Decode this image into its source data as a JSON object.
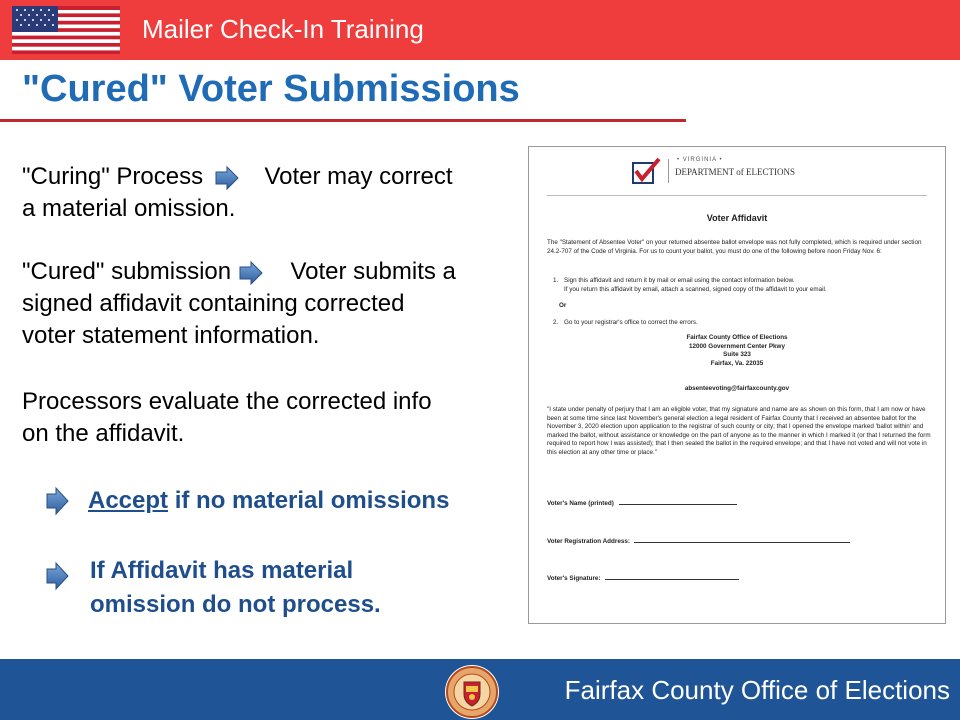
{
  "header": {
    "title": "Mailer Check-In Training"
  },
  "slide": {
    "title": "\"Cured\" Voter Submissions"
  },
  "content": {
    "curing_term": "\"Curing\" Process",
    "curing_desc_1": "Voter may correct",
    "curing_desc_2": "a material omission.",
    "cured_term": "\"Cured\" submission",
    "cured_desc_1": "Voter submits a",
    "cured_desc_2": "signed affidavit containing corrected",
    "cured_desc_3": "voter statement information.",
    "processors_1": "Processors evaluate the corrected info",
    "processors_2": "on the affidavit.",
    "accept_word": "Accept",
    "accept_rest": " if no material omissions",
    "reject_1": "If Affidavit has material",
    "reject_2": "omission do not process."
  },
  "affidavit": {
    "state": "• VIRGINIA •",
    "department": "DEPARTMENT of ELECTIONS",
    "title": "Voter Affidavit",
    "intro": "The \"Statement of Absentee Voter\" on your returned absentee ballot envelope was not fully completed, which is required under section 24.2-707 of the Code of Virginia. For us to count your ballot, you must do one of the following before noon Friday Nov. 6:",
    "step1_num": "1.",
    "step1": "Sign this affidavit and return it by mail or email using the contact information below.",
    "step1_note": "If you return this affidavit by email, attach a scanned, signed copy of the affidavit to your email.",
    "or": "Or",
    "step2_num": "2.",
    "step2": "Go to your registrar's office to correct the errors.",
    "office_name": "Fairfax County Office of Elections",
    "office_street": "12000 Government Center Pkwy",
    "office_suite": "Suite 323",
    "office_city": "Fairfax, Va. 22035",
    "email": "absenteevoting@fairfaxcounty.gov",
    "statement": "\"I state under penalty of perjury that I am an eligible voter, that my signature and name are as shown on this form, that I am now or have been at some time since last November's general election a legal resident of Fairfax County that I received an absentee ballot for the November 3, 2020 election upon application to the registrar of such county or city; that I opened the envelope marked 'ballot within' and marked the ballot, without assistance or knowledge on the part of anyone as to the manner in which I marked it (or that I returned the form required to report how I was assisted); that I then sealed the ballot in the required envelope; and that I have not voted and will not vote in this election at any other time or place.\"",
    "field_name": "Voter's Name (printed)",
    "field_address": "Voter Registration Address:",
    "field_signature": "Voter's Signature:"
  },
  "footer": {
    "org": "Fairfax County Office of Elections"
  },
  "colors": {
    "header_red": "#ef3c3c",
    "title_blue": "#1f6bb5",
    "footer_blue": "#1f5596",
    "rule_red": "#c0282d",
    "emphasis_blue": "#1f4e8c"
  }
}
